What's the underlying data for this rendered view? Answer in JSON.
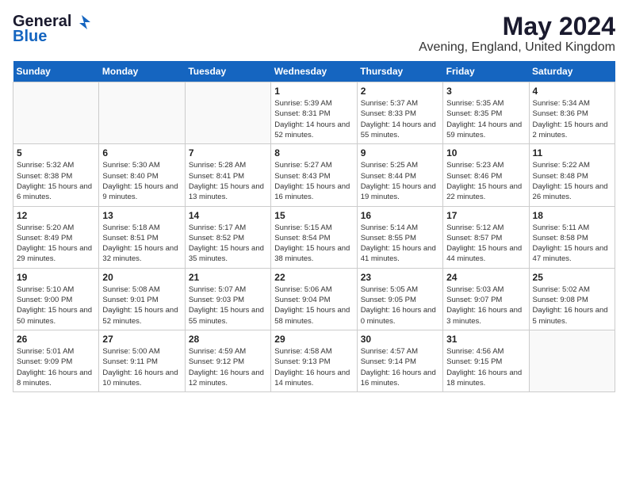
{
  "logo": {
    "general": "General",
    "blue": "Blue"
  },
  "title": {
    "month_year": "May 2024",
    "location": "Avening, England, United Kingdom"
  },
  "days_of_week": [
    "Sunday",
    "Monday",
    "Tuesday",
    "Wednesday",
    "Thursday",
    "Friday",
    "Saturday"
  ],
  "weeks": [
    [
      {
        "day": "",
        "info": ""
      },
      {
        "day": "",
        "info": ""
      },
      {
        "day": "",
        "info": ""
      },
      {
        "day": "1",
        "info": "Sunrise: 5:39 AM\nSunset: 8:31 PM\nDaylight: 14 hours and 52 minutes."
      },
      {
        "day": "2",
        "info": "Sunrise: 5:37 AM\nSunset: 8:33 PM\nDaylight: 14 hours and 55 minutes."
      },
      {
        "day": "3",
        "info": "Sunrise: 5:35 AM\nSunset: 8:35 PM\nDaylight: 14 hours and 59 minutes."
      },
      {
        "day": "4",
        "info": "Sunrise: 5:34 AM\nSunset: 8:36 PM\nDaylight: 15 hours and 2 minutes."
      }
    ],
    [
      {
        "day": "5",
        "info": "Sunrise: 5:32 AM\nSunset: 8:38 PM\nDaylight: 15 hours and 6 minutes."
      },
      {
        "day": "6",
        "info": "Sunrise: 5:30 AM\nSunset: 8:40 PM\nDaylight: 15 hours and 9 minutes."
      },
      {
        "day": "7",
        "info": "Sunrise: 5:28 AM\nSunset: 8:41 PM\nDaylight: 15 hours and 13 minutes."
      },
      {
        "day": "8",
        "info": "Sunrise: 5:27 AM\nSunset: 8:43 PM\nDaylight: 15 hours and 16 minutes."
      },
      {
        "day": "9",
        "info": "Sunrise: 5:25 AM\nSunset: 8:44 PM\nDaylight: 15 hours and 19 minutes."
      },
      {
        "day": "10",
        "info": "Sunrise: 5:23 AM\nSunset: 8:46 PM\nDaylight: 15 hours and 22 minutes."
      },
      {
        "day": "11",
        "info": "Sunrise: 5:22 AM\nSunset: 8:48 PM\nDaylight: 15 hours and 26 minutes."
      }
    ],
    [
      {
        "day": "12",
        "info": "Sunrise: 5:20 AM\nSunset: 8:49 PM\nDaylight: 15 hours and 29 minutes."
      },
      {
        "day": "13",
        "info": "Sunrise: 5:18 AM\nSunset: 8:51 PM\nDaylight: 15 hours and 32 minutes."
      },
      {
        "day": "14",
        "info": "Sunrise: 5:17 AM\nSunset: 8:52 PM\nDaylight: 15 hours and 35 minutes."
      },
      {
        "day": "15",
        "info": "Sunrise: 5:15 AM\nSunset: 8:54 PM\nDaylight: 15 hours and 38 minutes."
      },
      {
        "day": "16",
        "info": "Sunrise: 5:14 AM\nSunset: 8:55 PM\nDaylight: 15 hours and 41 minutes."
      },
      {
        "day": "17",
        "info": "Sunrise: 5:12 AM\nSunset: 8:57 PM\nDaylight: 15 hours and 44 minutes."
      },
      {
        "day": "18",
        "info": "Sunrise: 5:11 AM\nSunset: 8:58 PM\nDaylight: 15 hours and 47 minutes."
      }
    ],
    [
      {
        "day": "19",
        "info": "Sunrise: 5:10 AM\nSunset: 9:00 PM\nDaylight: 15 hours and 50 minutes."
      },
      {
        "day": "20",
        "info": "Sunrise: 5:08 AM\nSunset: 9:01 PM\nDaylight: 15 hours and 52 minutes."
      },
      {
        "day": "21",
        "info": "Sunrise: 5:07 AM\nSunset: 9:03 PM\nDaylight: 15 hours and 55 minutes."
      },
      {
        "day": "22",
        "info": "Sunrise: 5:06 AM\nSunset: 9:04 PM\nDaylight: 15 hours and 58 minutes."
      },
      {
        "day": "23",
        "info": "Sunrise: 5:05 AM\nSunset: 9:05 PM\nDaylight: 16 hours and 0 minutes."
      },
      {
        "day": "24",
        "info": "Sunrise: 5:03 AM\nSunset: 9:07 PM\nDaylight: 16 hours and 3 minutes."
      },
      {
        "day": "25",
        "info": "Sunrise: 5:02 AM\nSunset: 9:08 PM\nDaylight: 16 hours and 5 minutes."
      }
    ],
    [
      {
        "day": "26",
        "info": "Sunrise: 5:01 AM\nSunset: 9:09 PM\nDaylight: 16 hours and 8 minutes."
      },
      {
        "day": "27",
        "info": "Sunrise: 5:00 AM\nSunset: 9:11 PM\nDaylight: 16 hours and 10 minutes."
      },
      {
        "day": "28",
        "info": "Sunrise: 4:59 AM\nSunset: 9:12 PM\nDaylight: 16 hours and 12 minutes."
      },
      {
        "day": "29",
        "info": "Sunrise: 4:58 AM\nSunset: 9:13 PM\nDaylight: 16 hours and 14 minutes."
      },
      {
        "day": "30",
        "info": "Sunrise: 4:57 AM\nSunset: 9:14 PM\nDaylight: 16 hours and 16 minutes."
      },
      {
        "day": "31",
        "info": "Sunrise: 4:56 AM\nSunset: 9:15 PM\nDaylight: 16 hours and 18 minutes."
      },
      {
        "day": "",
        "info": ""
      }
    ]
  ]
}
